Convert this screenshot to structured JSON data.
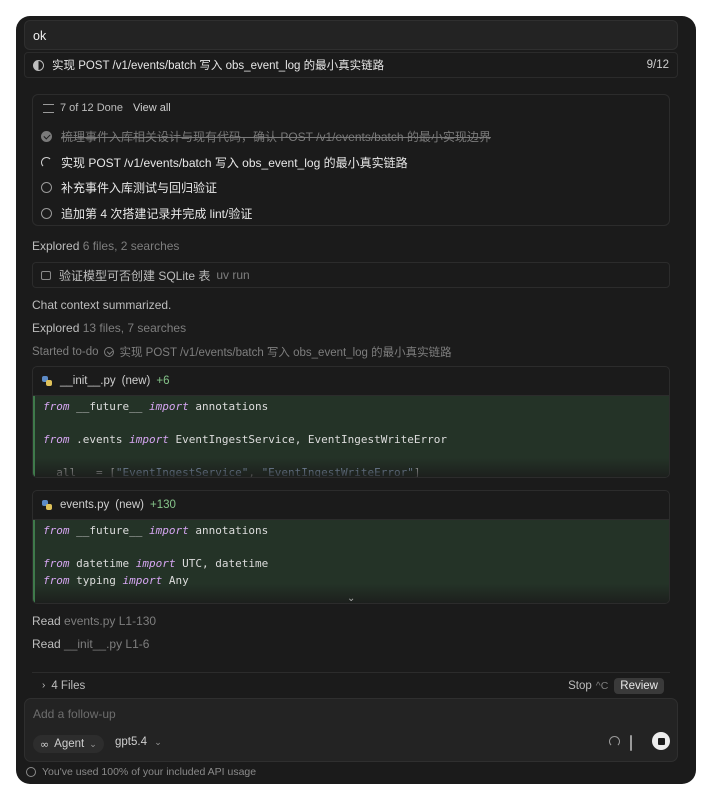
{
  "user_message": "ok",
  "top_status": {
    "text": "实现 POST /v1/events/batch 写入 obs_event_log 的最小真实链路",
    "count": "9/12"
  },
  "todo": {
    "summary": "7 of 12 Done",
    "view_all": "View all",
    "items": [
      {
        "label": "梳理事件入库相关设计与现有代码，确认 POST /v1/events/batch 的最小实现边界",
        "state": "done"
      },
      {
        "label": "实现 POST /v1/events/batch 写入 obs_event_log 的最小真实链路",
        "state": "in-progress"
      },
      {
        "label": "补充事件入库测试与回归验证",
        "state": "pending"
      },
      {
        "label": "追加第 4 次搭建记录并完成 lint/验证",
        "state": "pending"
      }
    ]
  },
  "explored1": {
    "label": "Explored",
    "detail": "6 files, 2 searches"
  },
  "terminal": {
    "label": "验证模型可否创建 SQLite 表",
    "cmd": "uv run"
  },
  "chat_summarized": "Chat context summarized.",
  "explored2": {
    "label": "Explored",
    "detail": "13 files, 7 searches"
  },
  "started": {
    "label": "Started to-do",
    "task": "实现 POST /v1/events/batch 写入 obs_event_log 的最小真实链路"
  },
  "file1": {
    "name": "__init__.py",
    "tag": "(new)",
    "added": "+6",
    "lines": [
      [
        {
          "t": "from",
          "k": "kw"
        },
        {
          "t": " __future__ "
        },
        {
          "t": "import",
          "k": "kw"
        },
        {
          "t": " annotations"
        }
      ],
      [],
      [
        {
          "t": "from",
          "k": "kw"
        },
        {
          "t": " .events "
        },
        {
          "t": "import",
          "k": "kw"
        },
        {
          "t": " EventIngestService, EventIngestWriteError"
        }
      ],
      [],
      [
        {
          "t": "__all__ = ["
        },
        {
          "t": "\"EventIngestService\"",
          "k": "str"
        },
        {
          "t": ", "
        },
        {
          "t": "\"EventIngestWriteError\"",
          "k": "str"
        },
        {
          "t": "]"
        }
      ]
    ]
  },
  "file2": {
    "name": "events.py",
    "tag": "(new)",
    "added": "+130",
    "lines": [
      [
        {
          "t": "from",
          "k": "kw"
        },
        {
          "t": " __future__ "
        },
        {
          "t": "import",
          "k": "kw"
        },
        {
          "t": " annotations"
        }
      ],
      [],
      [
        {
          "t": "from",
          "k": "kw"
        },
        {
          "t": " datetime "
        },
        {
          "t": "import",
          "k": "kw"
        },
        {
          "t": " UTC, datetime"
        }
      ],
      [
        {
          "t": "from",
          "k": "kw"
        },
        {
          "t": " typing "
        },
        {
          "t": "import",
          "k": "kw"
        },
        {
          "t": " Any"
        }
      ]
    ]
  },
  "read1": {
    "label": "Read",
    "detail": "events.py L1-130"
  },
  "read2": {
    "label": "Read",
    "detail": "__init__.py L1-6"
  },
  "files_bar": {
    "files": "4 Files",
    "stop": "Stop",
    "shortcut": "^C",
    "review": "Review"
  },
  "composer": {
    "placeholder": "Add a follow-up",
    "agent": "Agent",
    "model": "gpt5.4"
  },
  "usage": "You've used 100% of your included API usage",
  "colors": {
    "window_bg": "#1b1b1b",
    "added_green": "#86c48a",
    "code_bg": "#243327"
  }
}
